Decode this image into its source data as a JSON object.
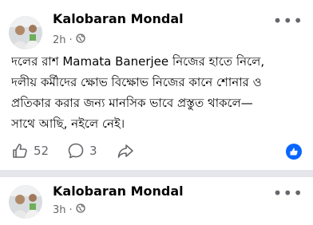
{
  "posts": [
    {
      "author": "Kalobaran Mondal",
      "time": "2h",
      "privacy_icon": "globe-icon",
      "menu_icon": "more-icon",
      "text_lines": [
        "দলের রাশ Mamata Banerjee নিজের হাতে নিলে,",
        "দলীয় কর্মীদের ক্ষোভ বিক্ষোভ নিজের কানে শোনার ও",
        "প্রতিকার করার জন্য মানসিক ভাবে প্রস্তুত থাকলে—",
        "সাথে আছি, নইলে নেই।"
      ],
      "actions": {
        "likes": "52",
        "comments": "3",
        "like_icon": "thumbs-up-icon",
        "comment_icon": "comment-icon",
        "share_icon": "share-icon",
        "fab_icon": "like-badge-icon"
      }
    },
    {
      "author": "Kalobaran Mondal",
      "time": "3h",
      "privacy_icon": "globe-icon",
      "menu_icon": "more-icon"
    }
  ],
  "colors": {
    "accent": "#0866ff",
    "secondary_text": "#65676b",
    "separator": "#e4e6eb"
  }
}
